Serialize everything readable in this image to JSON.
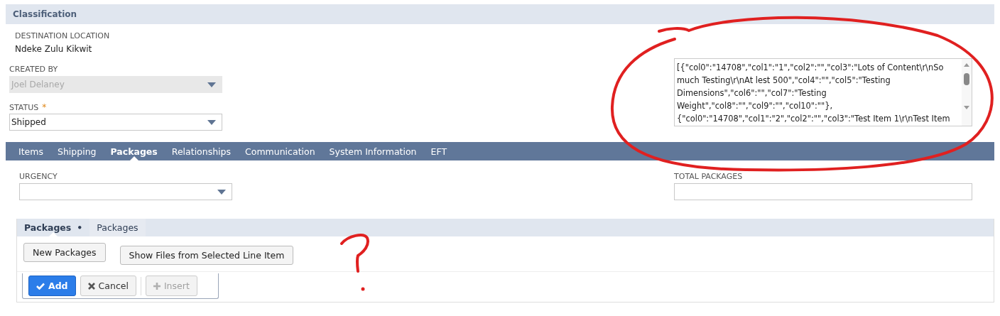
{
  "section": {
    "title": "Classification"
  },
  "destination_location": {
    "label": "DESTINATION LOCATION",
    "value": "Ndeke Zulu Kikwit"
  },
  "created_by": {
    "label": "CREATED BY",
    "value": "Joel Delaney",
    "disabled": true
  },
  "status": {
    "label": "STATUS",
    "required_mark": "*",
    "value": "Shipped",
    "disabled": false
  },
  "textarea": {
    "lines": [
      "[{\"col0\":\"14708\",\"col1\":\"1\",\"col2\":\"\",\"col3\":\"Lots of Content\\r\\nSo",
      "much Testing\\r\\nAt lest 500\",\"col4\":\"\",\"col5\":\"Testing",
      "Dimensions\",\"col6\":\"\",\"col7\":\"Testing",
      "Weight\",\"col8\":\"\",\"col9\":\"\",\"col10\":\"\"},",
      "{\"col0\":\"14708\",\"col1\":\"2\",\"col2\":\"\",\"col3\":\"Test Item 1\\r\\nTest Item"
    ]
  },
  "tabs": [
    {
      "label": "Items",
      "selected": false
    },
    {
      "label": "Shipping",
      "selected": false
    },
    {
      "label": "Packages",
      "selected": true
    },
    {
      "label": "Relationships",
      "selected": false
    },
    {
      "label": "Communication",
      "selected": false
    },
    {
      "label": "System Information",
      "selected": false
    },
    {
      "label": "EFT",
      "selected": false
    }
  ],
  "urgency": {
    "label": "URGENCY"
  },
  "total_packages": {
    "label": "TOTAL PACKAGES"
  },
  "subtabs": [
    {
      "label": "Packages",
      "marker": "•",
      "selected": true
    },
    {
      "label": "Packages",
      "selected": false
    }
  ],
  "buttons": [
    "New Packages",
    "Show Files from Selected Line Item"
  ],
  "line_actions": [
    {
      "kind": "add",
      "label": "Add",
      "disabled": false
    },
    {
      "kind": "cancel",
      "label": "Cancel",
      "disabled": false
    },
    {
      "kind": "insert",
      "label": "Insert",
      "disabled": true
    }
  ]
}
